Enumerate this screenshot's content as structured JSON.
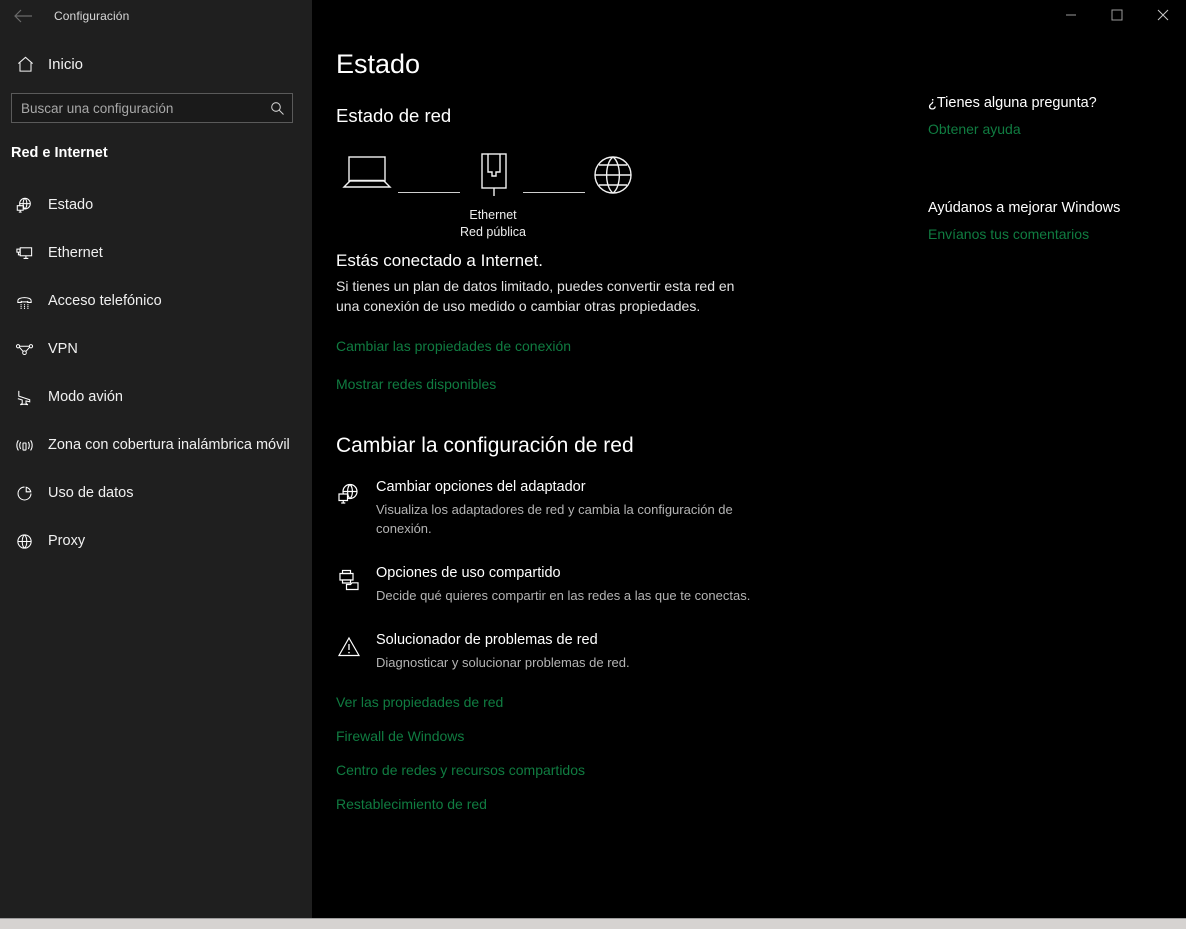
{
  "window": {
    "title": "Configuración",
    "back_icon": "back-arrow-icon",
    "minimize_icon": "minimize-icon",
    "maximize_icon": "maximize-icon",
    "close_icon": "close-icon"
  },
  "sidebar": {
    "home_label": "Inicio",
    "home_icon": "home-icon",
    "search": {
      "placeholder": "Buscar una configuración",
      "value": "",
      "icon": "search-icon"
    },
    "category": "Red e Internet",
    "items": [
      {
        "label": "Estado",
        "icon": "network-status-icon",
        "selected": true
      },
      {
        "label": "Ethernet",
        "icon": "ethernet-monitor-icon",
        "selected": false
      },
      {
        "label": "Acceso telefónico",
        "icon": "dial-up-phone-icon",
        "selected": false
      },
      {
        "label": "VPN",
        "icon": "vpn-icon",
        "selected": false
      },
      {
        "label": "Modo avión",
        "icon": "airplane-icon",
        "selected": false
      },
      {
        "label": "Zona con cobertura inalámbrica móvil",
        "icon": "mobile-hotspot-icon",
        "selected": false
      },
      {
        "label": "Uso de datos",
        "icon": "data-usage-pie-icon",
        "selected": false
      },
      {
        "label": "Proxy",
        "icon": "globe-icon",
        "selected": false
      }
    ]
  },
  "main": {
    "page_title": "Estado",
    "network_status_heading": "Estado de red",
    "diagram": {
      "device_icon": "laptop-icon",
      "adapter_icon": "ethernet-port-icon",
      "internet_icon": "globe-icon",
      "adapter_name": "Ethernet",
      "network_type": "Red pública"
    },
    "connection_state": "Estás conectado a Internet.",
    "connection_description": "Si tienes un plan de datos limitado, puedes convertir esta red en una conexión de uso medido o cambiar otras propiedades.",
    "link_change_properties": "Cambiar las propiedades de conexión",
    "link_show_networks": "Mostrar redes disponibles",
    "change_settings_heading": "Cambiar la configuración de red",
    "options": [
      {
        "icon": "network-adapter-icon",
        "title": "Cambiar opciones del adaptador",
        "subtitle": "Visualiza los adaptadores de red y cambia la configuración de conexión."
      },
      {
        "icon": "sharing-printer-folder-icon",
        "title": "Opciones de uso compartido",
        "subtitle": "Decide qué quieres compartir en las redes a las que te conectas."
      },
      {
        "icon": "warning-triangle-icon",
        "title": "Solucionador de problemas de red",
        "subtitle": "Diagnosticar y solucionar problemas de red."
      }
    ],
    "bottom_links": [
      "Ver las propiedades de red",
      "Firewall de Windows",
      "Centro de redes y recursos compartidos",
      "Restablecimiento de red"
    ]
  },
  "right_pane": {
    "question_heading": "¿Tienes alguna pregunta?",
    "help_link": "Obtener ayuda",
    "improve_heading": "Ayúdanos a mejorar Windows",
    "feedback_link": "Envíanos tus comentarios"
  },
  "colors": {
    "accent_link": "#107c41",
    "sidebar_bg": "#1f1f1f",
    "content_bg": "#000000",
    "text_primary": "#ffffff",
    "text_secondary": "#b4b4b4"
  }
}
